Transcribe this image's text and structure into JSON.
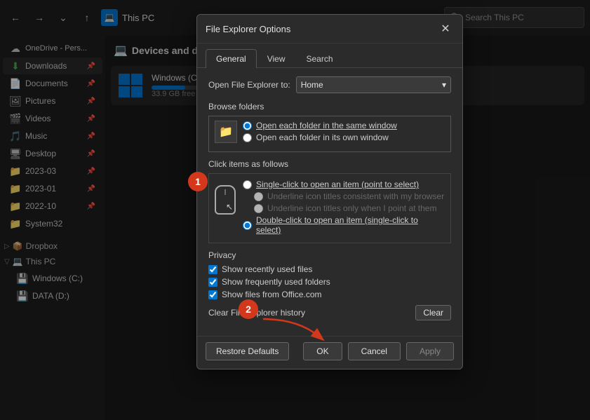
{
  "titlebar": {
    "back_label": "←",
    "forward_label": "→",
    "down_label": "⌄",
    "up_label": "↑",
    "window_icon": "💻",
    "window_title": "This PC",
    "search_placeholder": "Search This PC"
  },
  "sidebar": {
    "onedrive_label": "OneDrive - Pers...",
    "items": [
      {
        "id": "downloads",
        "label": "Downloads",
        "icon": "⬇",
        "pinned": true
      },
      {
        "id": "documents",
        "label": "Documents",
        "icon": "📄",
        "pinned": true
      },
      {
        "id": "pictures",
        "label": "Pictures",
        "icon": "🖼",
        "pinned": true
      },
      {
        "id": "videos",
        "label": "Videos",
        "icon": "🎬",
        "pinned": true
      },
      {
        "id": "music",
        "label": "Music",
        "icon": "🎵",
        "pinned": true
      },
      {
        "id": "desktop",
        "label": "Desktop",
        "icon": "🖥",
        "pinned": true
      },
      {
        "id": "folder1",
        "label": "2023-03",
        "icon": "📁",
        "pinned": true
      },
      {
        "id": "folder2",
        "label": "2023-01",
        "icon": "📁",
        "pinned": true
      },
      {
        "id": "folder3",
        "label": "2022-10",
        "icon": "📁",
        "pinned": true
      },
      {
        "id": "folder4",
        "label": "System32",
        "icon": "📁",
        "pinned": false
      }
    ],
    "dropbox_label": "Dropbox",
    "thispc_label": "This PC",
    "windows_c_label": "Windows (C:)",
    "data_d_label": "DATA (D:)"
  },
  "content": {
    "title": "Devices and driv...",
    "device_name": "Windows (C:)",
    "device_sub": "33.9 GB free"
  },
  "dialog": {
    "title": "File Explorer Options",
    "close_label": "✕",
    "tabs": [
      {
        "id": "general",
        "label": "General",
        "active": true
      },
      {
        "id": "view",
        "label": "View",
        "active": false
      },
      {
        "id": "search",
        "label": "Search",
        "active": false
      }
    ],
    "open_label": "Open File Explorer to:",
    "open_value": "Home",
    "browse_label": "Browse folders",
    "same_window_label": "Open each folder in the same window",
    "own_window_label": "Open each folder in its own window",
    "click_label": "Click items as follows",
    "single_click_label": "Single-click to open an item (point to select)",
    "underline_browser_label": "Underline icon titles consistent with my browser",
    "underline_point_label": "Underline icon titles only when I point at them",
    "double_click_label": "Double-click to open an item (single-click to select)",
    "privacy_label": "Privacy",
    "show_recent_label": "Show recently used files",
    "show_frequent_label": "Show frequently used folders",
    "show_office_label": "Show files from Office.com",
    "clear_history_label": "Clear File Explorer history",
    "clear_btn": "Clear",
    "restore_btn": "Restore Defaults",
    "ok_btn": "OK",
    "cancel_btn": "Cancel",
    "apply_btn": "Apply"
  },
  "annotations": {
    "circle1_label": "1",
    "circle2_label": "2"
  },
  "colors": {
    "accent": "#0078d4",
    "annotation": "#d4381c"
  }
}
